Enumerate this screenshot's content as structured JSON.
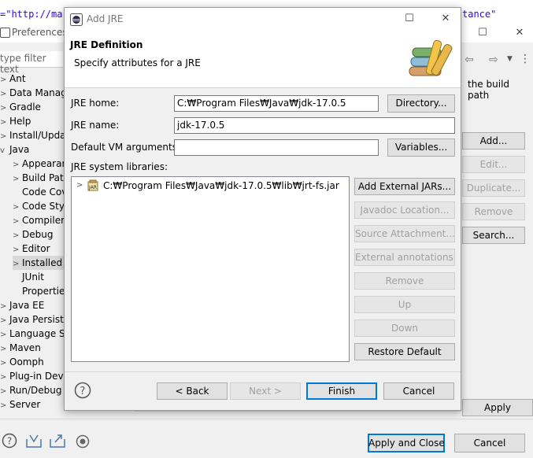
{
  "background_code": {
    "left": "=\"http://ma",
    "right": "tance\""
  },
  "preferences": {
    "title": "Preferences",
    "filter_placeholder": "type filter text",
    "tree": [
      {
        "label": "Ant",
        "level": 0,
        "expander": ">"
      },
      {
        "label": "Data Manag",
        "level": 0,
        "expander": ">"
      },
      {
        "label": "Gradle",
        "level": 0,
        "expander": ">"
      },
      {
        "label": "Help",
        "level": 0,
        "expander": ">"
      },
      {
        "label": "Install/Updat",
        "level": 0,
        "expander": ">"
      },
      {
        "label": "Java",
        "level": 0,
        "expander": "v"
      },
      {
        "label": "Appearan",
        "level": 1,
        "expander": ">"
      },
      {
        "label": "Build Path",
        "level": 1,
        "expander": ">"
      },
      {
        "label": "Code Cov",
        "level": 1,
        "expander": ""
      },
      {
        "label": "Code Sty",
        "level": 1,
        "expander": ">"
      },
      {
        "label": "Compiler",
        "level": 1,
        "expander": ">"
      },
      {
        "label": "Debug",
        "level": 1,
        "expander": ">"
      },
      {
        "label": "Editor",
        "level": 1,
        "expander": ">"
      },
      {
        "label": "Installed .",
        "level": 1,
        "expander": ">",
        "selected": true
      },
      {
        "label": "JUnit",
        "level": 1,
        "expander": ""
      },
      {
        "label": "Properties",
        "level": 1,
        "expander": ""
      },
      {
        "label": "Java EE",
        "level": 0,
        "expander": ">"
      },
      {
        "label": "Java Persiste",
        "level": 0,
        "expander": ">"
      },
      {
        "label": "Language Se",
        "level": 0,
        "expander": ">"
      },
      {
        "label": "Maven",
        "level": 0,
        "expander": ">"
      },
      {
        "label": "Oomph",
        "level": 0,
        "expander": ">"
      },
      {
        "label": "Plug-in Deve",
        "level": 0,
        "expander": ">"
      },
      {
        "label": "Run/Debug",
        "level": 0,
        "expander": ">"
      },
      {
        "label": "Server",
        "level": 0,
        "expander": ">"
      }
    ],
    "right_text": "the build path",
    "side_buttons": [
      {
        "label": "Add...",
        "enabled": true
      },
      {
        "label": "Edit...",
        "enabled": false
      },
      {
        "label": "Duplicate...",
        "enabled": false
      },
      {
        "label": "Remove",
        "enabled": false
      },
      {
        "label": "Search...",
        "enabled": true
      }
    ],
    "apply_label": "Apply",
    "apply_close_label": "Apply and Close",
    "cancel_label": "Cancel"
  },
  "dialog": {
    "title": "Add JRE",
    "heading": "JRE Definition",
    "subtitle": "Specify attributes for a JRE",
    "jre_home_label": "JRE home:",
    "jre_home_value": "C:₩Program Files₩Java₩jdk-17.0.5",
    "directory_button": "Directory...",
    "jre_name_label": "JRE name:",
    "jre_name_value": "jdk-17.0.5",
    "vm_args_label": "Default VM arguments:",
    "vm_args_value": "",
    "variables_button": "Variables...",
    "libraries_label": "JRE system libraries:",
    "library_entry": "C:₩Program Files₩Java₩jdk-17.0.5₩lib₩jrt-fs.jar",
    "lib_buttons": [
      {
        "label": "Add External JARs...",
        "enabled": true
      },
      {
        "label": "Javadoc Location...",
        "enabled": false
      },
      {
        "label": "Source Attachment...",
        "enabled": false
      },
      {
        "label": "External annotations...",
        "enabled": false
      },
      {
        "label": "Remove",
        "enabled": false
      },
      {
        "label": "Up",
        "enabled": false
      },
      {
        "label": "Down",
        "enabled": false
      },
      {
        "label": "Restore Default",
        "enabled": true
      }
    ],
    "back_button": "< Back",
    "next_button": "Next >",
    "finish_button": "Finish",
    "cancel_button": "Cancel"
  }
}
